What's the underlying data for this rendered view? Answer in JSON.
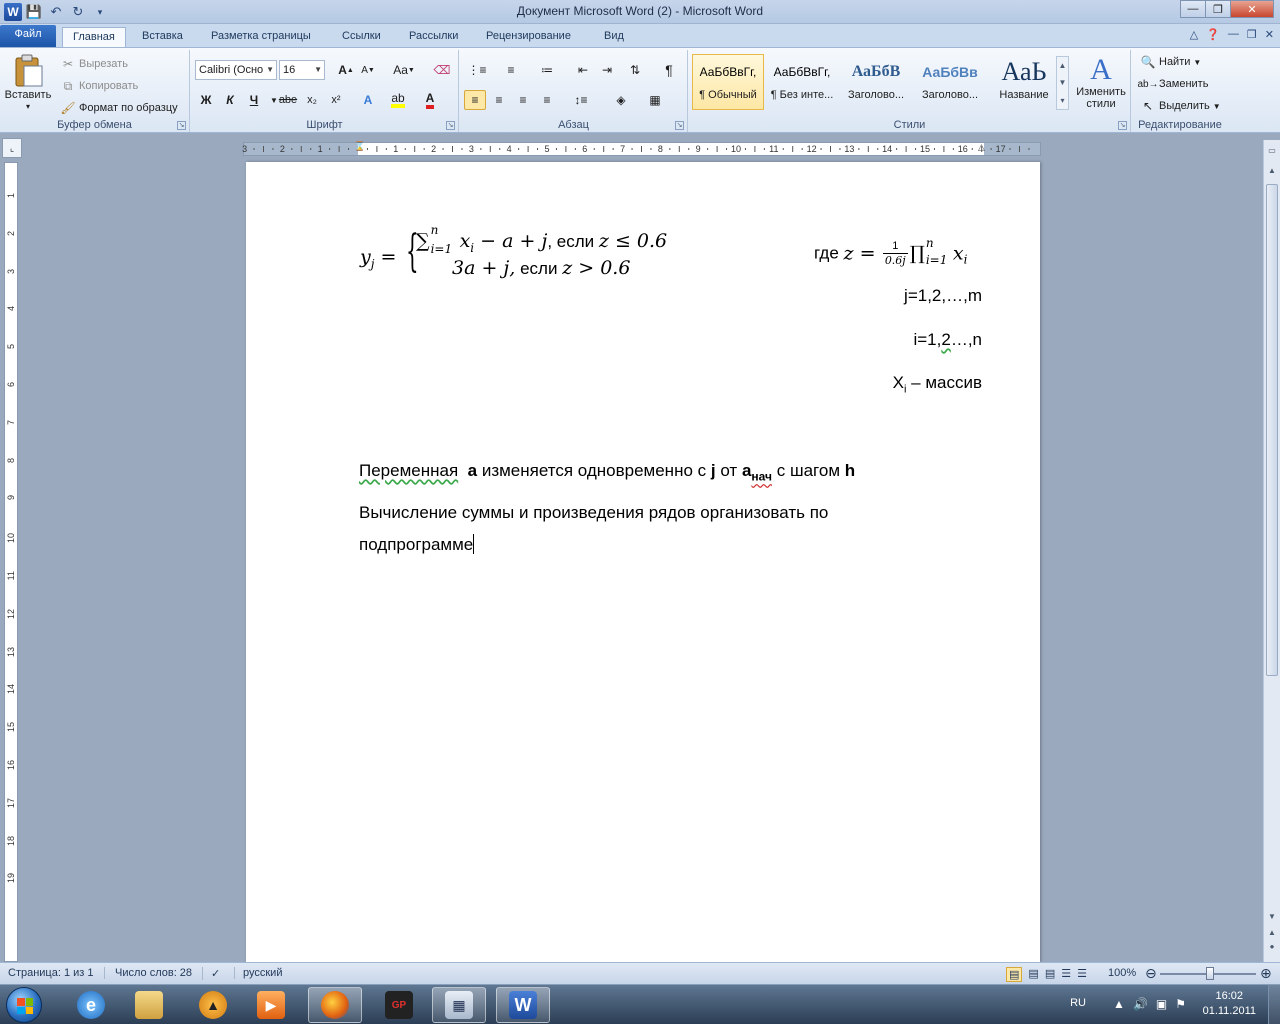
{
  "window": {
    "title": "Документ Microsoft Word (2)  -  Microsoft Word",
    "app_icon_letter": "W"
  },
  "tabs": {
    "file": "Файл",
    "items": [
      "Главная",
      "Вставка",
      "Разметка страницы",
      "Ссылки",
      "Рассылки",
      "Рецензирование",
      "Вид"
    ]
  },
  "ribbon": {
    "clipboard": {
      "label": "Буфер обмена",
      "paste": "Вставить",
      "cut": "Вырезать",
      "copy": "Копировать",
      "format_painter": "Формат по образцу"
    },
    "font": {
      "label": "Шрифт",
      "name": "Calibri (Осно",
      "size": "16",
      "bold": "Ж",
      "italic": "К",
      "underline": "Ч",
      "strike": "abe",
      "sub": "x₂",
      "sup": "x²",
      "grow": "A",
      "shrink": "A",
      "case": "Aa",
      "color": "A"
    },
    "paragraph": {
      "label": "Абзац",
      "pilcrow": "¶"
    },
    "styles": {
      "label": "Стили",
      "items": [
        {
          "preview": "АаБбВвГг,",
          "name": "¶ Обычный"
        },
        {
          "preview": "АаБбВвГг,",
          "name": "¶ Без инте..."
        },
        {
          "preview": "АаБбВ",
          "name": "Заголово..."
        },
        {
          "preview": "АаБбВв",
          "name": "Заголово..."
        },
        {
          "preview": "АаЬ",
          "name": "Название"
        }
      ],
      "change_styles": "Изменить стили"
    },
    "editing": {
      "label": "Редактирование",
      "find": "Найти",
      "replace": "Заменить",
      "select": "Выделить"
    }
  },
  "ruler": {
    "h_numbers": [
      "3",
      "2",
      "1",
      "1",
      "2",
      "3",
      "4",
      "5",
      "6",
      "7",
      "8",
      "9",
      "10",
      "11",
      "12",
      "13",
      "14",
      "15",
      "16",
      "17"
    ],
    "v_numbers": [
      "1",
      "2",
      "3",
      "4",
      "5",
      "6",
      "7",
      "8",
      "9",
      "10",
      "11",
      "12",
      "13",
      "14",
      "15",
      "16",
      "17",
      "18",
      "19"
    ]
  },
  "document": {
    "formula": {
      "y": "y",
      "y_sub": "j",
      "eq": "=",
      "line1": {
        "sum": "∑",
        "sum_sub": "i=1",
        "sum_sup": "n",
        "body": "x",
        "body_sub": "i",
        "rest": " − a + j",
        "cond_word": ", если ",
        "cond": "z ≤ 0.6"
      },
      "line2": {
        "body": "3a + j,",
        "cond_word": " если ",
        "cond": "z > 0.6"
      }
    },
    "where": {
      "word": "где ",
      "z": "z =",
      "frac_num": "1",
      "frac_den": "0.6j",
      "prod": "∏",
      "prod_sub": "i=1",
      "prod_sup": "n",
      "x": "x",
      "x_sub": "i"
    },
    "j_range": "j=1,2,…,m",
    "i_range_a": "i=1,",
    "i_range_b": "2",
    "i_range_c": "…,n",
    "xi_label": "X",
    "xi_sub": "i",
    "xi_rest": " – массив",
    "line_a": {
      "p1": "Переменная",
      "p2": "a",
      "p3": " изменяется  одновременно  с ",
      "p4": "j",
      "p5": " от ",
      "p6": "a",
      "p6_sub": "нач",
      "p7": " с шагом ",
      "p8": "h"
    },
    "line_b1": "Вычисление  суммы и произведения  рядов организовать  по",
    "line_b2": "подпрограмме"
  },
  "status": {
    "page": "Страница: 1 из 1",
    "words": "Число слов: 28",
    "lang": "русский",
    "zoom": "100%"
  },
  "taskbar": {
    "lang": "RU",
    "time": "16:02",
    "date": "01.11.2011"
  }
}
